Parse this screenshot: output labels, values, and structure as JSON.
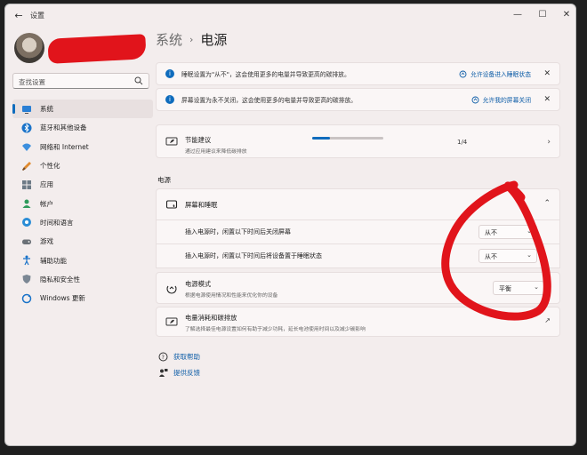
{
  "window": {
    "title": "设置"
  },
  "sidebar": {
    "search_placeholder": "查找设置",
    "items": [
      {
        "label": "系统",
        "icon": "monitor-icon",
        "active": true
      },
      {
        "label": "蓝牙和其他设备",
        "icon": "bluetooth-icon"
      },
      {
        "label": "网络和 Internet",
        "icon": "wifi-icon"
      },
      {
        "label": "个性化",
        "icon": "brush-icon"
      },
      {
        "label": "应用",
        "icon": "apps-icon"
      },
      {
        "label": "帐户",
        "icon": "account-icon"
      },
      {
        "label": "时间和语言",
        "icon": "globe-clock-icon"
      },
      {
        "label": "游戏",
        "icon": "gamepad-icon"
      },
      {
        "label": "辅助功能",
        "icon": "accessibility-icon"
      },
      {
        "label": "隐私和安全性",
        "icon": "shield-icon"
      },
      {
        "label": "Windows 更新",
        "icon": "update-icon"
      }
    ]
  },
  "breadcrumb": {
    "parent": "系统",
    "current": "电源"
  },
  "notices": [
    {
      "text": "睡眠设置为\"从不\"，这会使用更多的电量并导致更高的碳排放。",
      "link": "允许设备进入睡眠状态"
    },
    {
      "text": "屏幕设置为永不关闭，这会使用更多的电量并导致更高的碳排放。",
      "link": "允许我的屏幕关闭"
    }
  ],
  "energy": {
    "title": "节能建议",
    "subtitle": "通过应用建议来降低碳排放",
    "count": "1/4",
    "progress": 0.25
  },
  "power_section": {
    "label": "电源",
    "screen_sleep": {
      "title": "屏幕和睡眠",
      "rows": [
        {
          "label": "插入电源时，闲置以下时间后关闭屏幕",
          "value": "从不"
        },
        {
          "label": "插入电源时，闲置以下时间后将设备置于睡眠状态",
          "value": "从不"
        }
      ]
    },
    "power_mode": {
      "title": "电源模式",
      "subtitle": "根据电源使用情况和性能来优化你的设备",
      "value": "平衡"
    },
    "carbon": {
      "title": "电量消耗和碳排放",
      "subtitle": "了解选择最佳电源设置如何有助于减少功耗，延长电池使用时间以及减少碳影响"
    }
  },
  "links": {
    "help": "获取帮助",
    "feedback": "提供反馈"
  },
  "colors": {
    "accent": "#0f6cbd",
    "annotation": "#e1141b"
  }
}
